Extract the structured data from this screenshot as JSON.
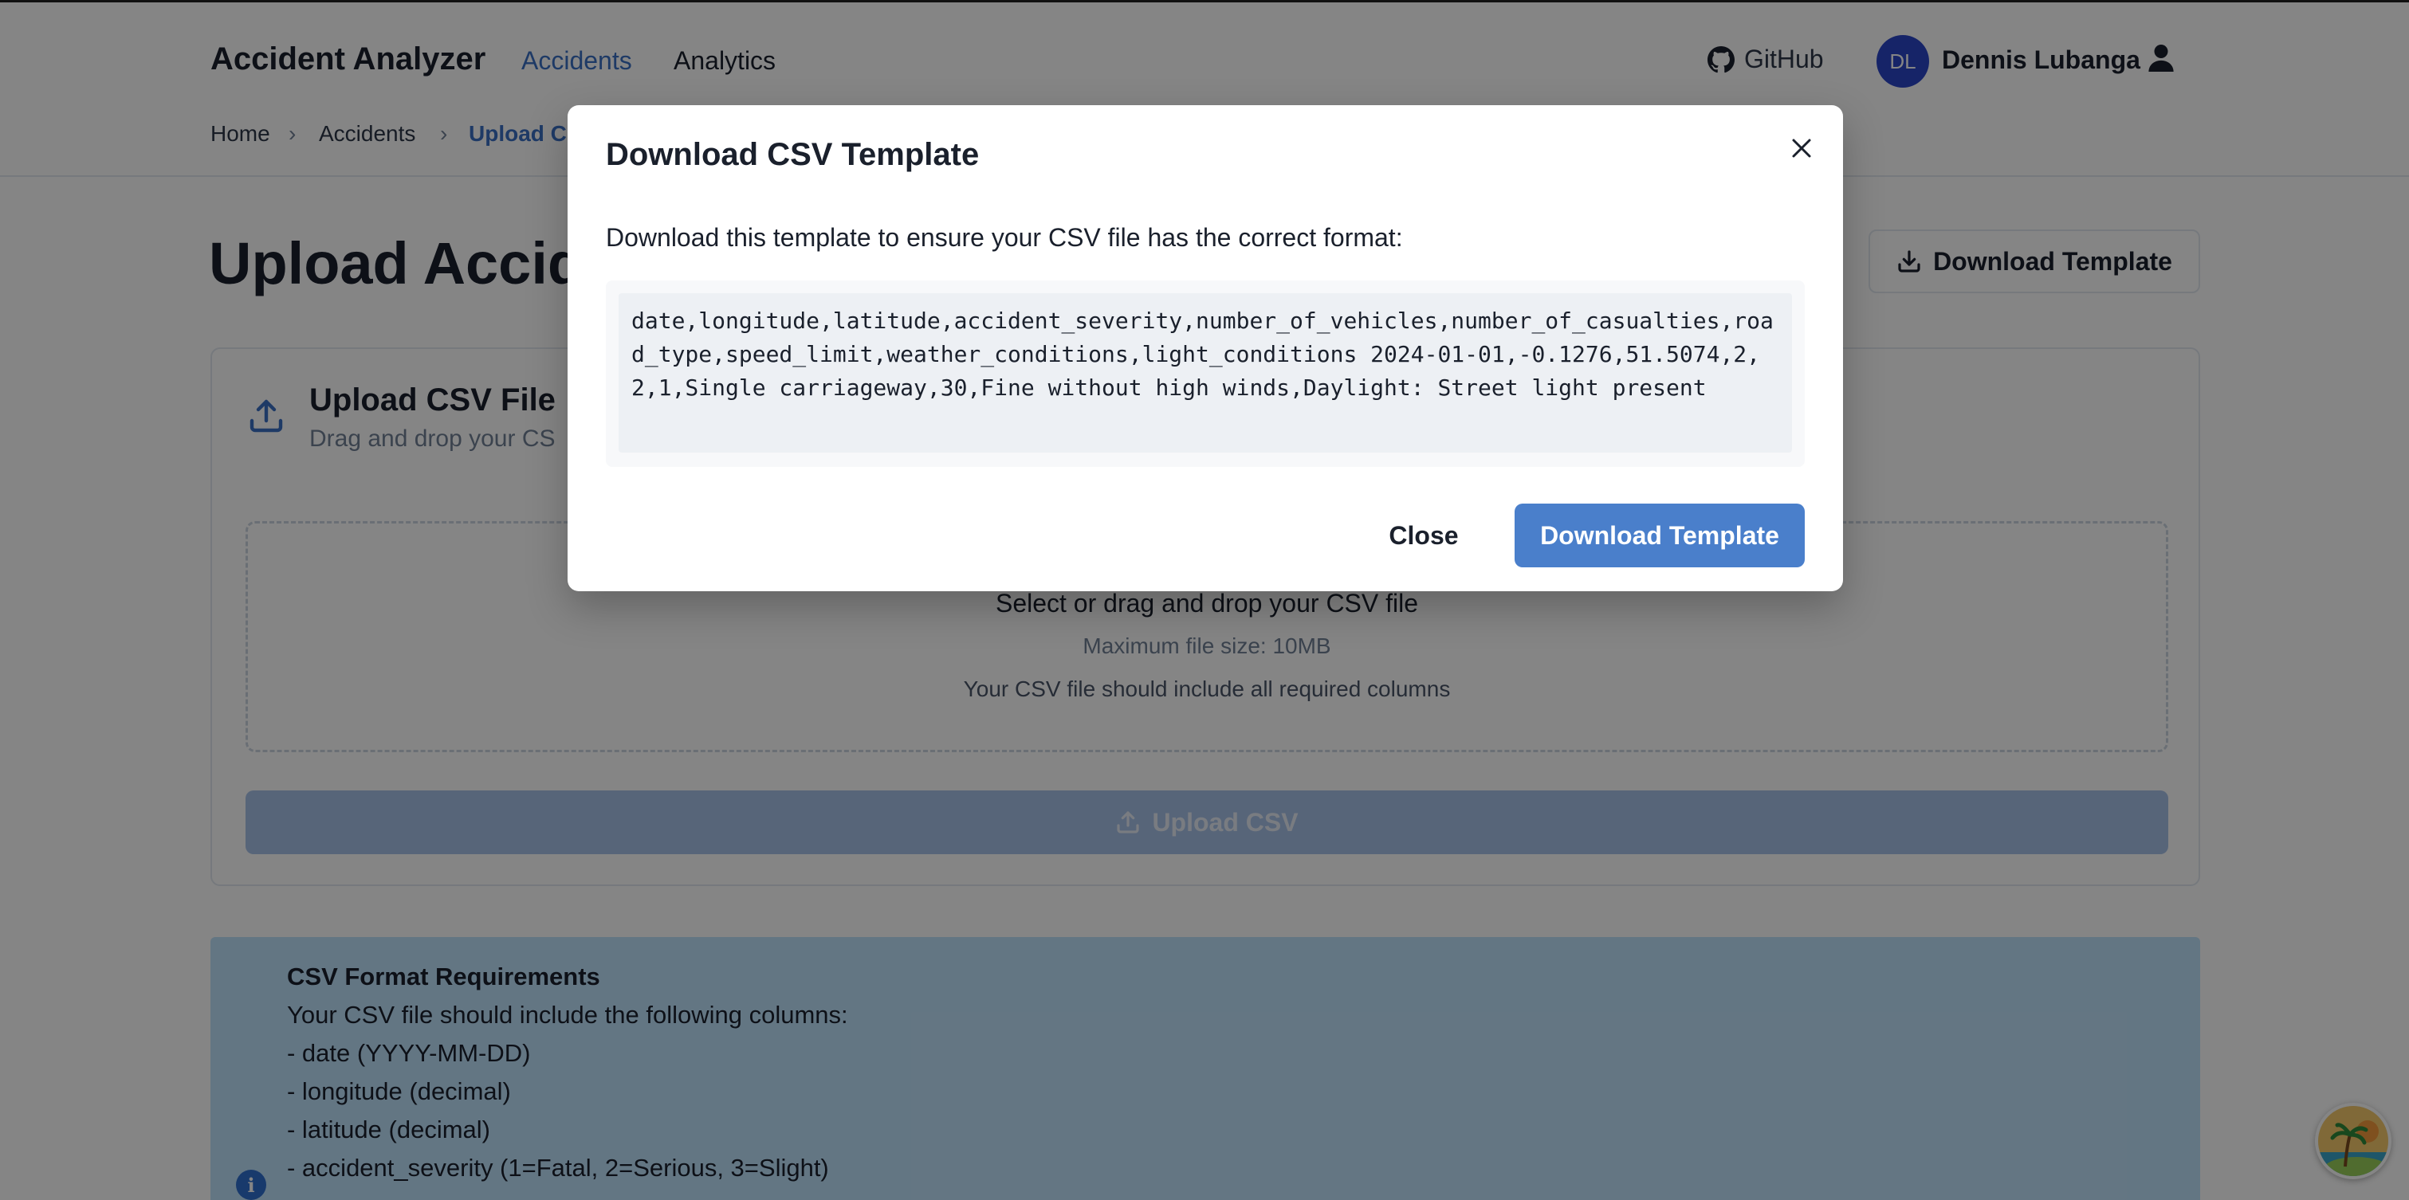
{
  "header": {
    "brand": "Accident Analyzer",
    "nav": [
      "Accidents",
      "Analytics"
    ],
    "github_label": "GitHub",
    "avatar_initials": "DL",
    "username": "Dennis Lubanga"
  },
  "breadcrumb": {
    "home": "Home",
    "accidents": "Accidents",
    "current": "Upload C",
    "separator": "›"
  },
  "page": {
    "title": "Upload Accid",
    "download_template_label": "Download Template"
  },
  "upload_card": {
    "title": "Upload CSV File",
    "subtitle": "Drag and drop your CS",
    "dropzone_main": "Select or drag and drop your CSV file",
    "dropzone_size": "Maximum file size: 10MB",
    "dropzone_columns": "Your CSV file should include all required columns",
    "upload_button": "Upload CSV"
  },
  "requirements": {
    "title": "CSV Format Requirements",
    "lines": [
      "Your CSV file should include the following columns:",
      "- date (YYYY-MM-DD)",
      "- longitude (decimal)",
      "- latitude (decimal)",
      "- accident_severity (1=Fatal, 2=Serious, 3=Slight)"
    ]
  },
  "modal": {
    "title": "Download CSV Template",
    "description": "Download this template to ensure your CSV file has the correct format:",
    "template_text": "date,longitude,latitude,accident_severity,number_of_vehicles,number_of_casualties,road_type,speed_limit,weather_conditions,light_conditions 2024-01-01,-0.1276,51.5074,2,2,1,Single carriageway,30,Fine without high winds,Daylight: Street light present",
    "close_label": "Close",
    "download_label": "Download Template"
  },
  "colors": {
    "accent": "#4a7fcb",
    "nav_active": "#3b6fc4",
    "avatar_bg": "#2b46c8",
    "info_bg": "#bfe2fb"
  },
  "icons": [
    "github-icon",
    "user-icon",
    "download-icon",
    "upload-icon",
    "close-icon",
    "info-icon",
    "palm-badge-icon"
  ]
}
